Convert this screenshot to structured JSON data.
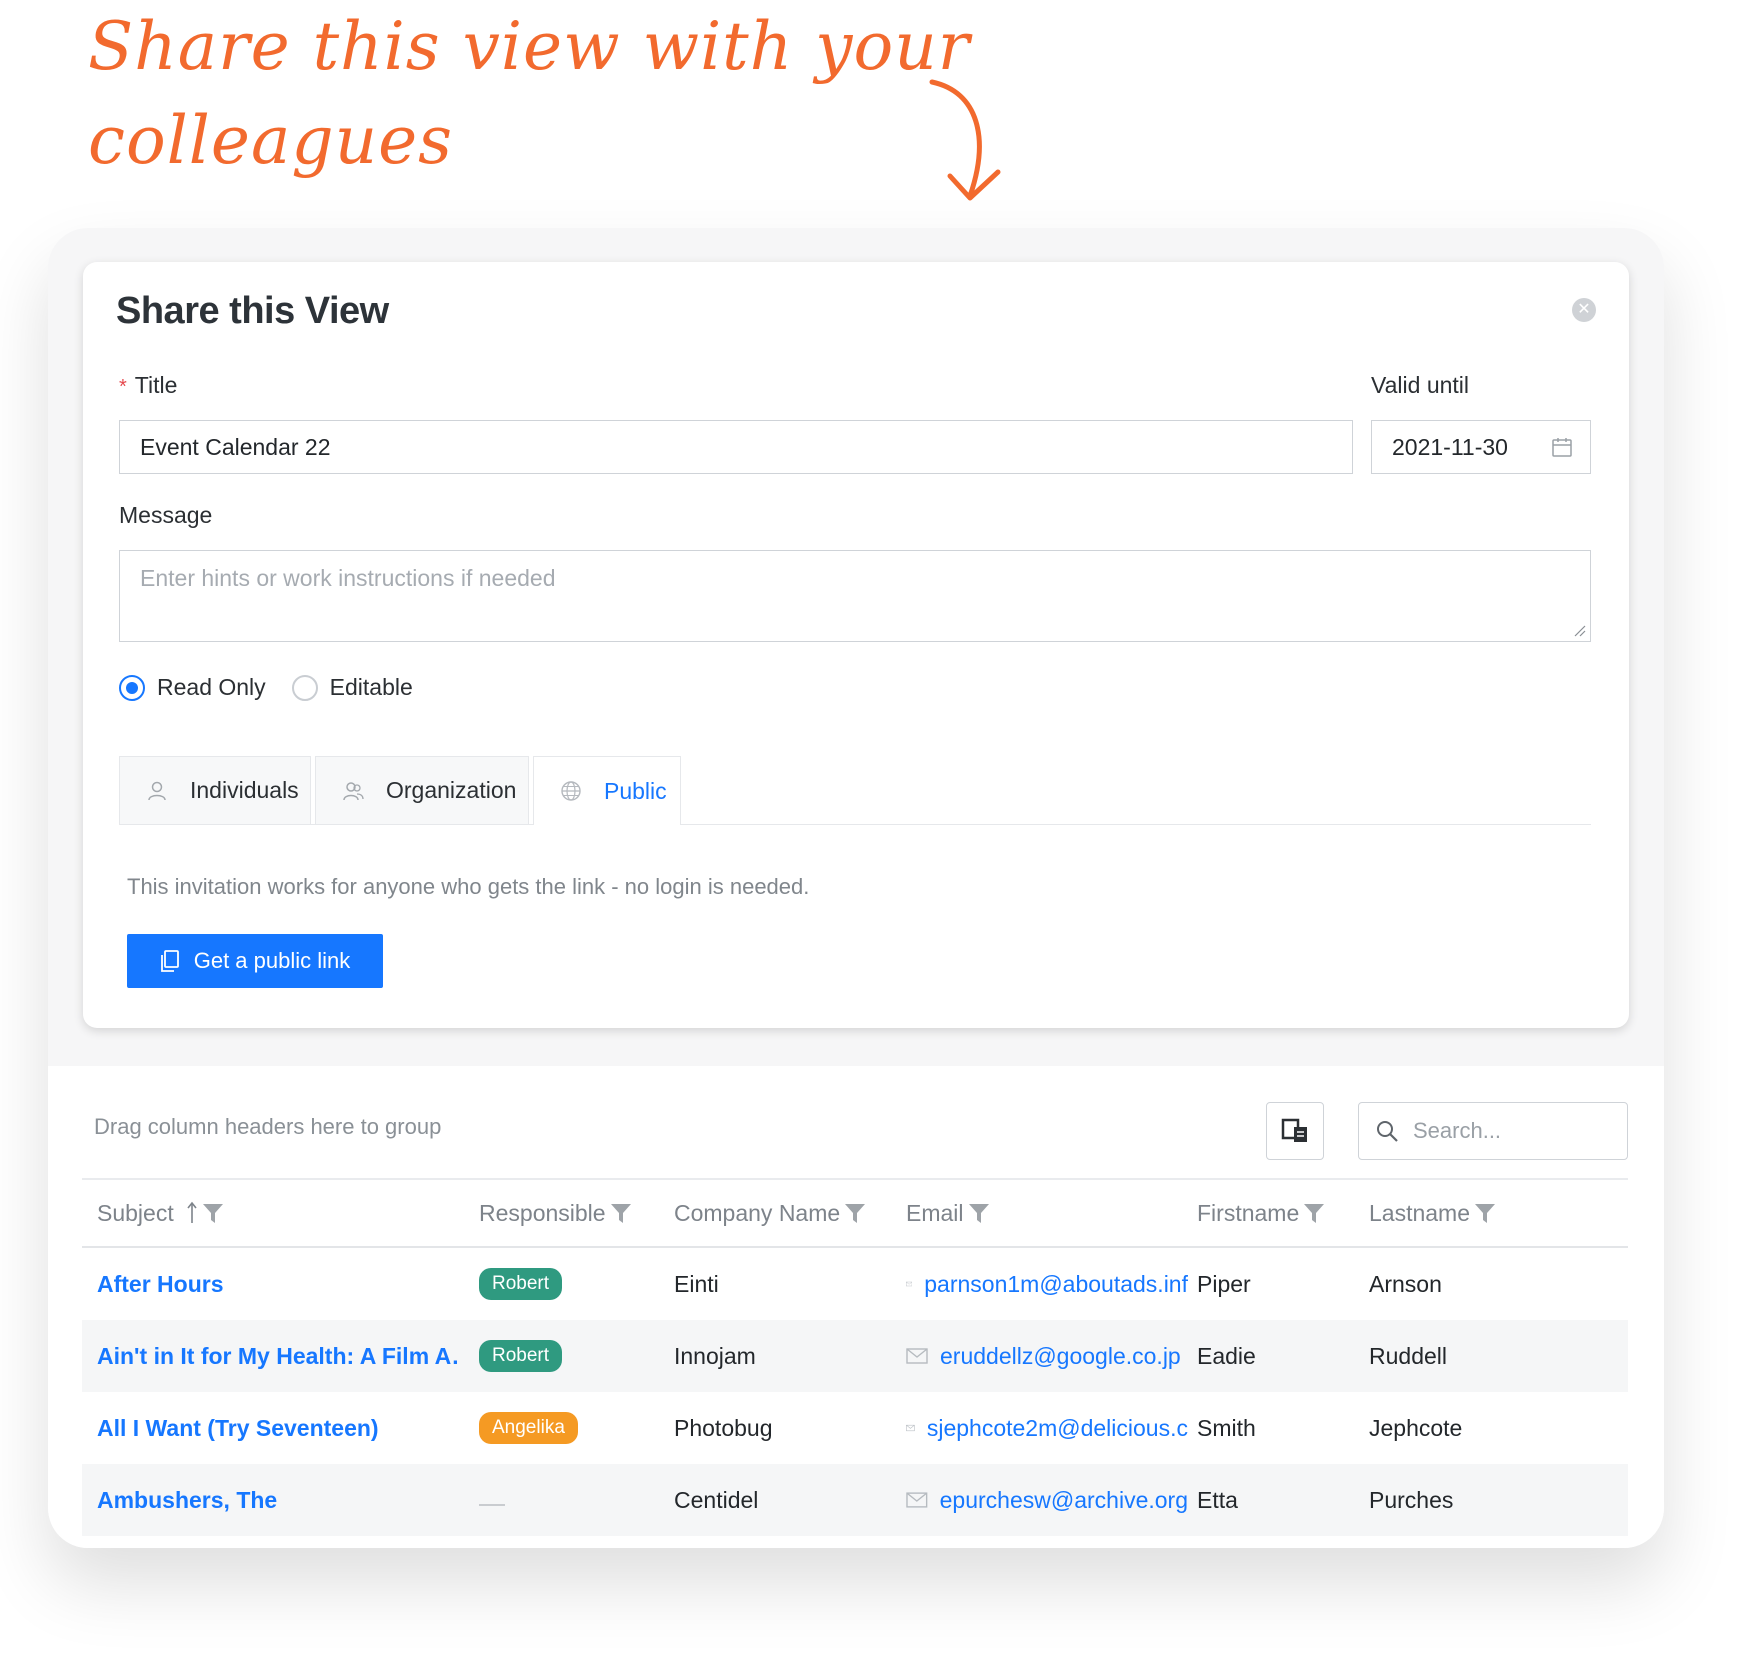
{
  "annotation": {
    "line1": "Share this view with your",
    "line2": "colleagues"
  },
  "dialog": {
    "title": "Share this View",
    "title_label": "Title",
    "required_mark": "*",
    "title_value": "Event Calendar 22",
    "valid_until_label": "Valid until",
    "valid_until_value": "2021-11-30",
    "message_label": "Message",
    "message_placeholder": "Enter hints or work instructions if needed",
    "access": {
      "read_only": "Read Only",
      "editable": "Editable",
      "selected": "Read Only"
    },
    "tabs": [
      {
        "label": "Individuals",
        "icon": "user-icon"
      },
      {
        "label": "Organization",
        "icon": "users-icon"
      },
      {
        "label": "Public",
        "icon": "globe-icon",
        "active": true
      }
    ],
    "info": "This invitation works for anyone who gets the link - no login is needed.",
    "button_label": "Get a public link"
  },
  "grid": {
    "group_hint": "Drag column headers here to group",
    "search_placeholder": "Search...",
    "columns": [
      "Subject",
      "Responsible",
      "Company Name",
      "Email",
      "Firstname",
      "Lastname"
    ],
    "rows": [
      {
        "subject": "After Hours",
        "responsible": "Robert",
        "responsible_color": "#2f9a80",
        "company": "Einti",
        "email": "parnson1m@aboutads.inf",
        "firstname": "Piper",
        "lastname": "Arnson"
      },
      {
        "subject": "Ain't in It for My Health: A Film A…",
        "responsible": "Robert",
        "responsible_color": "#2f9a80",
        "company": "Innojam",
        "email": "eruddellz@google.co.jp",
        "firstname": "Eadie",
        "lastname": "Ruddell"
      },
      {
        "subject": "All I Want (Try Seventeen)",
        "responsible": "Angelika",
        "responsible_color": "#f59a23",
        "company": "Photobug",
        "email": "sjephcote2m@delicious.c",
        "firstname": "Smith",
        "lastname": "Jephcote"
      },
      {
        "subject": "Ambushers, The",
        "responsible": "",
        "responsible_color": "",
        "company": "Centidel",
        "email": "epurchesw@archive.org",
        "firstname": "Etta",
        "lastname": "Purches"
      }
    ]
  },
  "colors": {
    "accent": "#1677ff",
    "annotation": "#f26a2e"
  }
}
